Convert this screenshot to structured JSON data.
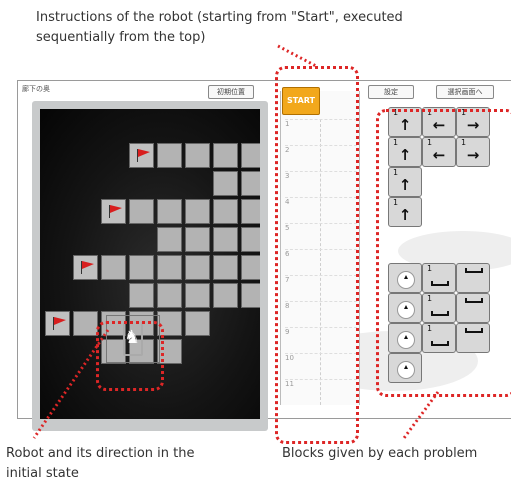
{
  "captions": {
    "instructions": "Instructions of the robot (starting from \"Start\", executed sequentially from the top)",
    "robot": "Robot and its direction in the initial state",
    "blocks": "Blocks given by each problem"
  },
  "app": {
    "title": "廊下の奥",
    "buttons": {
      "reset": "初期位置",
      "settings": "設定",
      "select_screen": "選択画面へ"
    },
    "start_label": "START",
    "row_numbers": [
      "1",
      "2",
      "3",
      "4",
      "5",
      "6",
      "7",
      "8",
      "9",
      "10",
      "11"
    ]
  },
  "blocks": {
    "move_number": "1",
    "glyphs": {
      "up": "↑",
      "left": "←",
      "right": "→"
    }
  },
  "colors": {
    "flag": "#d81e1e",
    "highlight": "#dd2626",
    "start": "#f2a81c",
    "tile": "#b3b3b3"
  }
}
